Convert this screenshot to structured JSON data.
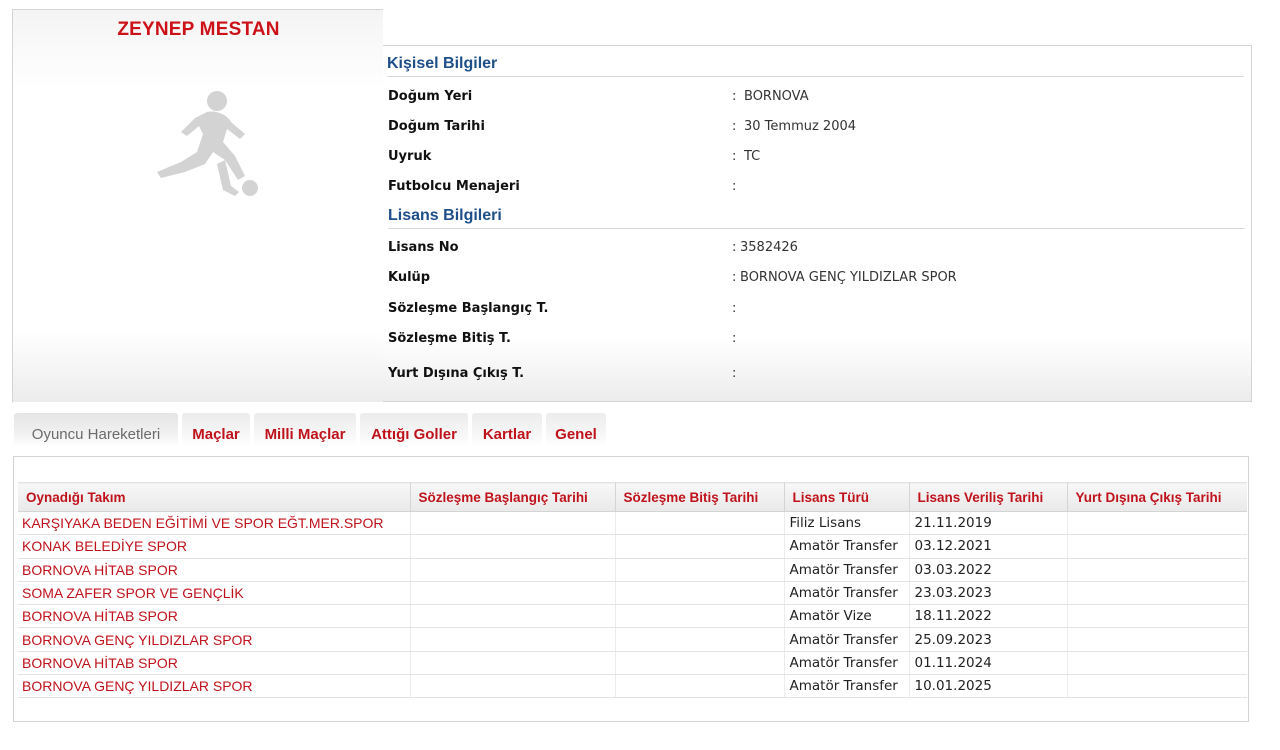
{
  "player": {
    "name": "ZEYNEP MESTAN"
  },
  "personal": {
    "title": "Kişisel Bilgiler",
    "rows": [
      {
        "label": "Doğum Yeri",
        "sep": ":",
        "value": "BORNOVA"
      },
      {
        "label": "Doğum Tarihi",
        "sep": ":",
        "value": "30 Temmuz 2004"
      },
      {
        "label": "Uyruk",
        "sep": ":",
        "value": "TC"
      },
      {
        "label": "Futbolcu Menajeri",
        "sep": ":",
        "value": ""
      }
    ]
  },
  "license": {
    "title": "Lisans Bilgileri",
    "rows": [
      {
        "label": "Lisans No",
        "sep": ":",
        "value": "3582426"
      },
      {
        "label": "Kulüp",
        "sep": ":",
        "value": "BORNOVA GENÇ YILDIZLAR SPOR"
      },
      {
        "label": "Sözleşme Başlangıç T.",
        "sep": ":",
        "value": ""
      },
      {
        "label": "Sözleşme Bitiş T.",
        "sep": ":",
        "value": ""
      },
      {
        "label": "Yurt Dışına Çıkış T.",
        "sep": ":",
        "value": ""
      }
    ]
  },
  "tabs": [
    {
      "label": "Oyuncu Hareketleri",
      "active": true
    },
    {
      "label": "Maçlar",
      "active": false
    },
    {
      "label": "Milli Maçlar",
      "active": false
    },
    {
      "label": "Attığı Goller",
      "active": false
    },
    {
      "label": "Kartlar",
      "active": false
    },
    {
      "label": "Genel",
      "active": false
    }
  ],
  "table": {
    "headers": [
      "Oynadığı Takım",
      "Sözleşme Başlangıç Tarihi",
      "Sözleşme Bitiş Tarihi",
      "Lisans Türü",
      "Lisans Veriliş Tarihi",
      "Yurt Dışına Çıkış Tarihi"
    ],
    "rows": [
      {
        "team": "KARŞIYAKA BEDEN EĞİTİMİ VE SPOR EĞT.MER.SPOR",
        "start": "",
        "end": "",
        "type": "Filiz Lisans",
        "issued": "21.11.2019",
        "abroad": ""
      },
      {
        "team": "KONAK BELEDİYE SPOR",
        "start": "",
        "end": "",
        "type": "Amatör Transfer",
        "issued": "03.12.2021",
        "abroad": ""
      },
      {
        "team": "BORNOVA HİTAB SPOR",
        "start": "",
        "end": "",
        "type": "Amatör Transfer",
        "issued": "03.03.2022",
        "abroad": ""
      },
      {
        "team": "SOMA ZAFER SPOR VE GENÇLİK",
        "start": "",
        "end": "",
        "type": "Amatör Transfer",
        "issued": "23.03.2023",
        "abroad": ""
      },
      {
        "team": "BORNOVA HİTAB SPOR",
        "start": "",
        "end": "",
        "type": "Amatör Vize",
        "issued": "18.11.2022",
        "abroad": ""
      },
      {
        "team": "BORNOVA GENÇ YILDIZLAR SPOR",
        "start": "",
        "end": "",
        "type": "Amatör Transfer",
        "issued": "25.09.2023",
        "abroad": ""
      },
      {
        "team": "BORNOVA HİTAB SPOR",
        "start": "",
        "end": "",
        "type": "Amatör Transfer",
        "issued": "01.11.2024",
        "abroad": ""
      },
      {
        "team": "BORNOVA GENÇ YILDIZLAR SPOR",
        "start": "",
        "end": "",
        "type": "Amatör Transfer",
        "issued": "10.01.2025",
        "abroad": ""
      }
    ]
  },
  "colors": {
    "brand_red": "#cc1118",
    "link_red": "#c0121b",
    "section_blue": "#1f4f8a"
  },
  "icons": {
    "player_photo": "football-player-silhouette-icon"
  }
}
